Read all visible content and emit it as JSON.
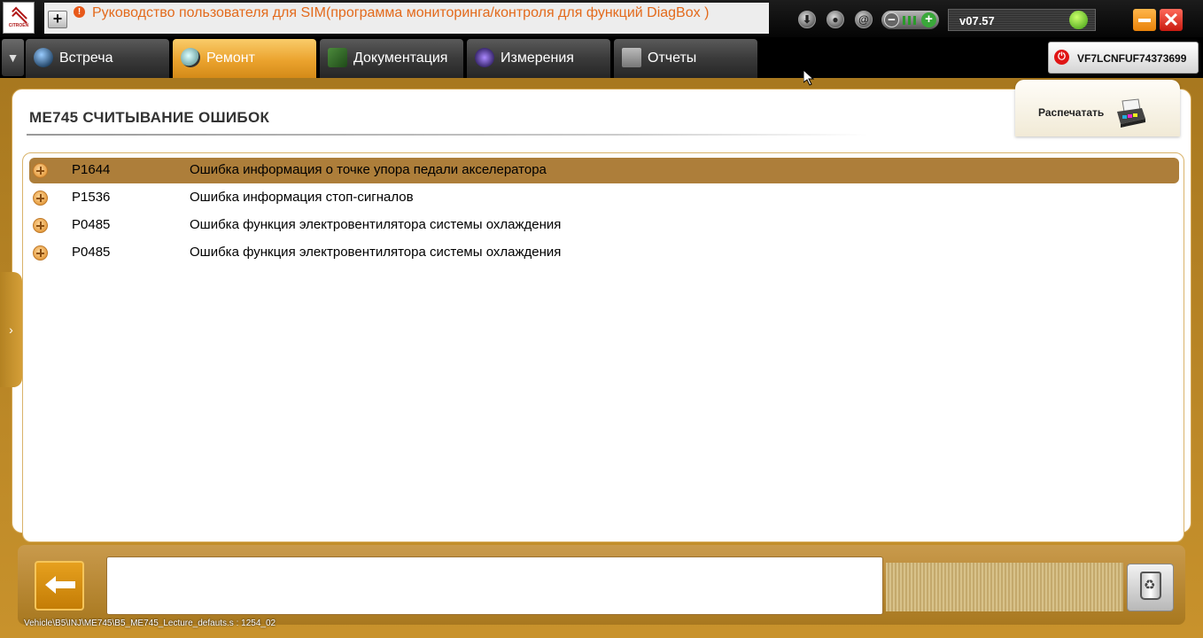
{
  "app": {
    "brand_text": "CITROËN",
    "help_text": "Руководство пользователя для SIM(программа мониторинга/контроля для  функций DiagBox )",
    "version": "v07.57",
    "vin": "VF7LCNFUF74373699",
    "icons": [
      "download-icon",
      "user-icon",
      "at-icon",
      "volume-control",
      "status-led-icon",
      "minimize-icon",
      "close-icon"
    ]
  },
  "tabs": [
    {
      "label": "Встреча",
      "icon": "globe-icon",
      "active": false
    },
    {
      "label": "Ремонт",
      "icon": "magnifier-icon",
      "active": true
    },
    {
      "label": "Документация",
      "icon": "book-icon",
      "active": false
    },
    {
      "label": "Измерения",
      "icon": "waveform-icon",
      "active": false
    },
    {
      "label": "Отчеты",
      "icon": "report-icon",
      "active": false
    }
  ],
  "page": {
    "title": "ME745  СЧИТЫВАНИЕ ОШИБОК",
    "print_label": "Распечатать"
  },
  "faults": [
    {
      "code": "P1644",
      "description": "Ошибка информация о точке упора педали акселератора",
      "selected": true
    },
    {
      "code": "P1536",
      "description": "Ошибка информация стоп-сигналов",
      "selected": false
    },
    {
      "code": "P0485",
      "description": "Ошибка функция электровентилятора системы охлаждения",
      "selected": false
    },
    {
      "code": "P0485",
      "description": "Ошибка функция электровентилятора системы охлаждения",
      "selected": false
    }
  ],
  "footer": {
    "path": "Vehicle\\B5\\INJ\\ME745\\B5_ME745_Lecture_defauts.s : 1254_02"
  },
  "colors": {
    "accent": "#eba32e",
    "frame": "#b88a2a",
    "selected_row": "#ad7e3a",
    "help_text": "#e36a1c"
  }
}
